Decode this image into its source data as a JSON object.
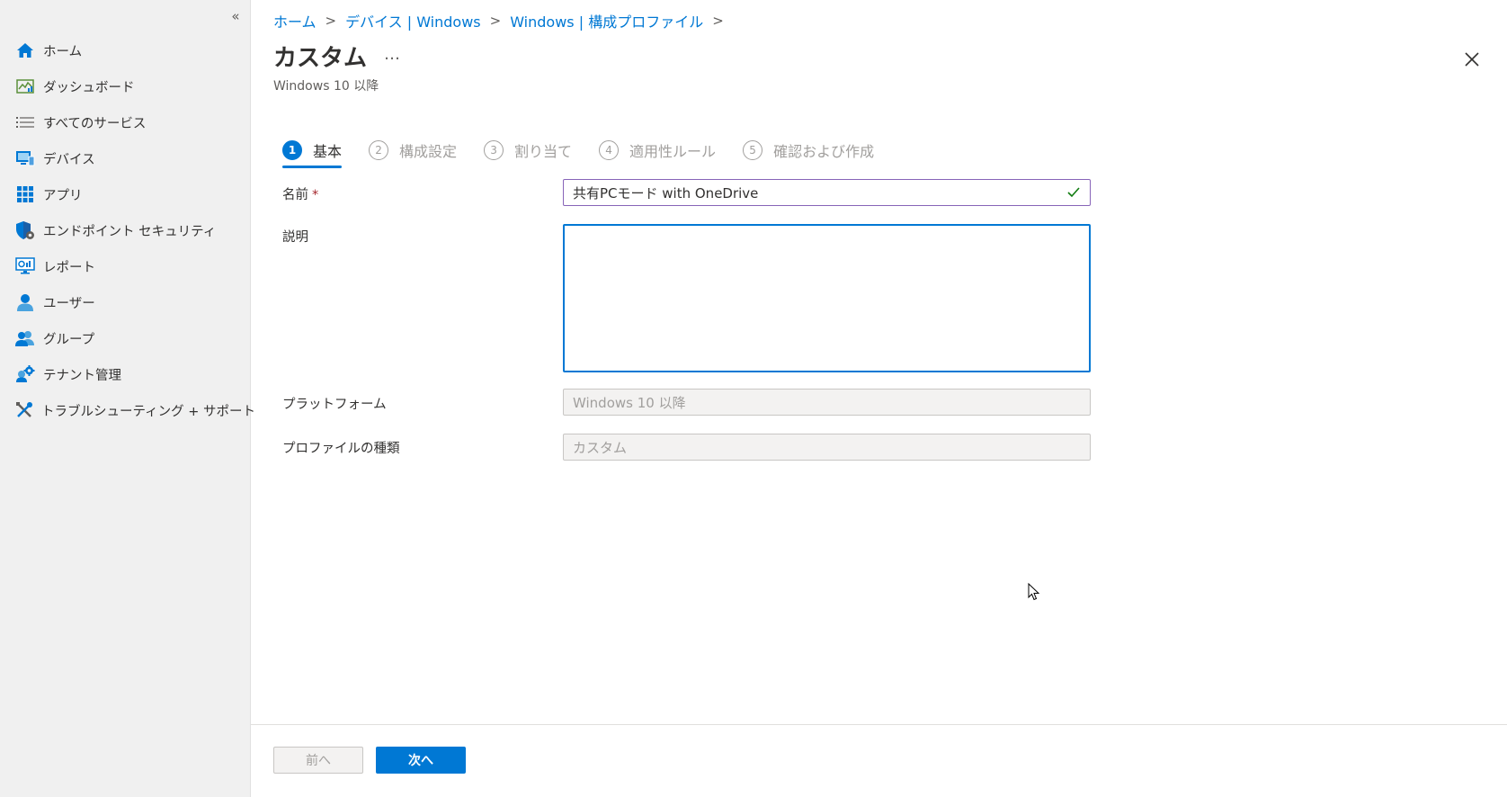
{
  "sidebar": {
    "collapse_icon": "«",
    "items": [
      {
        "label": "ホーム",
        "icon": "home-icon"
      },
      {
        "label": "ダッシュボード",
        "icon": "dashboard-icon"
      },
      {
        "label": "すべてのサービス",
        "icon": "list-icon"
      },
      {
        "label": "デバイス",
        "icon": "devices-icon"
      },
      {
        "label": "アプリ",
        "icon": "apps-icon"
      },
      {
        "label": "エンドポイント セキュリティ",
        "icon": "shield-icon"
      },
      {
        "label": "レポート",
        "icon": "reports-icon"
      },
      {
        "label": "ユーザー",
        "icon": "user-icon"
      },
      {
        "label": "グループ",
        "icon": "group-icon"
      },
      {
        "label": "テナント管理",
        "icon": "tenant-gear-icon"
      },
      {
        "label": "トラブルシューティング + サポート",
        "icon": "tools-icon"
      }
    ]
  },
  "breadcrumb": [
    {
      "label": "ホーム"
    },
    {
      "label": "デバイス | Windows"
    },
    {
      "label": "Windows | 構成プロファイル"
    }
  ],
  "header": {
    "title": "カスタム",
    "more": "…",
    "subtitle": "Windows 10 以降"
  },
  "steps": [
    {
      "num": "1",
      "label": "基本",
      "active": true
    },
    {
      "num": "2",
      "label": "構成設定",
      "active": false
    },
    {
      "num": "3",
      "label": "割り当て",
      "active": false
    },
    {
      "num": "4",
      "label": "適用性ルール",
      "active": false
    },
    {
      "num": "5",
      "label": "確認および作成",
      "active": false
    }
  ],
  "form": {
    "name_label": "名前",
    "required_mark": "*",
    "name_value": "共有PCモード with OneDrive",
    "description_label": "説明",
    "description_value": "",
    "platform_label": "プラットフォーム",
    "platform_value": "Windows 10 以降",
    "profile_type_label": "プロファイルの種類",
    "profile_type_value": "カスタム"
  },
  "footer": {
    "prev_label": "前へ",
    "next_label": "次へ"
  },
  "colors": {
    "accent": "#0078d4",
    "sidebar_bg": "#f0f0f0",
    "success": "#107c10"
  }
}
